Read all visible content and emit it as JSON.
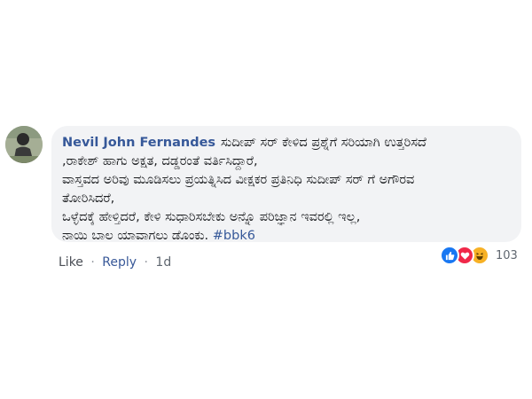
{
  "comment": {
    "author": "Nevil John Fernandes",
    "lines": [
      "ಸುದೀಪ್ ಸರ್ ಕೇಳಿದ ಪ್ರಶ್ನೆಗೆ ಸರಿಯಾಗಿ ಉತ್ತರಿಸದೆ",
      ",ರಾಕೇಶ್ ಹಾಗು ಅಕ್ಷತ, ದಡ್ಡರಂತೆ ವರ್ತಿಸಿದ್ದಾರೆ,",
      "ವಾಸ್ತವದ ಅರಿವು ಮೂಡಿಸಲು ಪ್ರಯತ್ನಿಸಿದ ವೀಕ್ಷಕರ ಪ್ರತಿನಿಧಿ ಸುದೀಪ್ ಸರ್ ಗೆ ಅಗೌರವ",
      "ತೋರಿಸಿದರೆ,",
      "ಒಳ್ಳೆದಕ್ಕೆ ಹೇಳ್ತಿದರೆ, ಕೇಳಿ ಸುಧಾರಿಸಬೇಕು ಅನ್ನೊ ಪರಿಜ್ಞಾನ ಇವರಲ್ಲಿ ಇಲ್ಲ,",
      "ನಾಯಿ ಬಾಲ ಯಾವಾಗಲು ಡೊಂಕು."
    ],
    "hashtag": "#bbk6"
  },
  "actions": {
    "like_label": "Like",
    "reply_label": "Reply",
    "separator": "·",
    "time": "1d"
  },
  "reactions": {
    "icons": [
      "like-icon",
      "love-icon",
      "haha-icon"
    ],
    "count": "103",
    "colors": {
      "like": "#1877f2",
      "love": "#f02849",
      "haha": "#f7b125",
      "link": "#365899"
    }
  }
}
